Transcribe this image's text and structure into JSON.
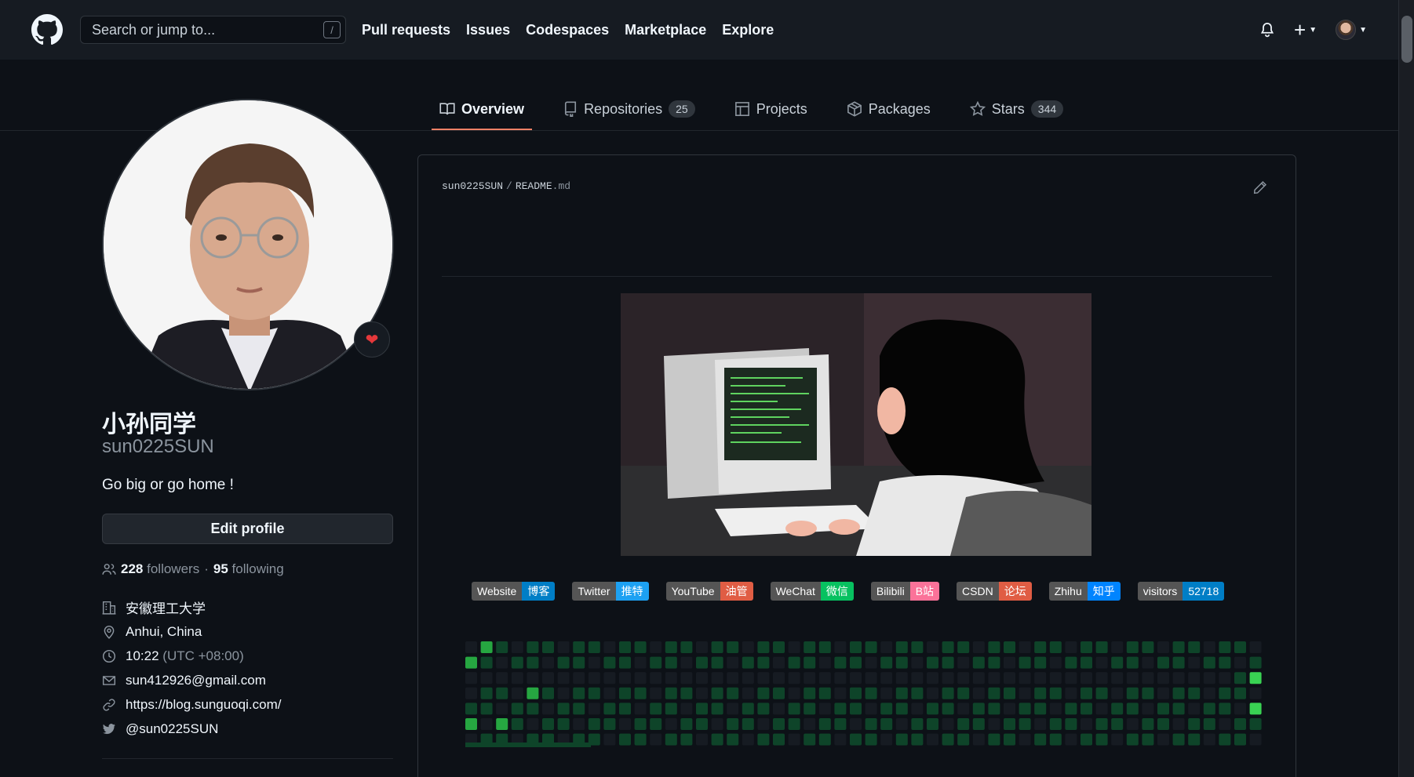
{
  "header": {
    "search_placeholder": "Search or jump to...",
    "search_shortcut": "/",
    "nav": [
      "Pull requests",
      "Issues",
      "Codespaces",
      "Marketplace",
      "Explore"
    ]
  },
  "tabs": [
    {
      "label": "Overview",
      "icon": "book-icon"
    },
    {
      "label": "Repositories",
      "count": "25",
      "icon": "repo-icon"
    },
    {
      "label": "Projects",
      "icon": "table-icon"
    },
    {
      "label": "Packages",
      "icon": "package-icon"
    },
    {
      "label": "Stars",
      "count": "344",
      "icon": "star-icon"
    }
  ],
  "profile": {
    "fullname": "小孙同学",
    "username": "sun0225SUN",
    "bio": "Go big or go home !",
    "edit_button": "Edit profile",
    "followers_count": "228",
    "followers_label": "followers",
    "dot": "·",
    "following_count": "95",
    "following_label": "following",
    "status_emoji": "❤",
    "details": {
      "organization": "安徽理工大学",
      "location": "Anhui, China",
      "time": "10:22",
      "timezone": "(UTC +08:00)",
      "email": "sun412926@gmail.com",
      "website": "https://blog.sunguoqi.com/",
      "twitter": "@sun0225SUN"
    }
  },
  "readme": {
    "owner": "sun0225SUN",
    "separator": "/",
    "filename": "README",
    "ext": ".md"
  },
  "badges": [
    {
      "left": "Website",
      "right": "博客",
      "color": "#007ec6"
    },
    {
      "left": "Twitter",
      "right": "推特",
      "color": "#1da1f2"
    },
    {
      "left": "YouTube",
      "right": "油管",
      "color": "#e05d44"
    },
    {
      "left": "WeChat",
      "right": "微信",
      "color": "#07c160"
    },
    {
      "left": "Bilibili",
      "right": "B站",
      "color": "#fb7299"
    },
    {
      "left": "CSDN",
      "right": "论坛",
      "color": "#e05d44"
    },
    {
      "left": "Zhihu",
      "right": "知乎",
      "color": "#0084ff"
    },
    {
      "left": "visitors",
      "right": "52718",
      "color": "#007ec6"
    }
  ],
  "colors": {
    "accent_tab": "#f78166",
    "contrib_level1": "#0e4429",
    "contrib_level3": "#26a641",
    "contrib_level4": "#39d353",
    "snake": "#800080"
  }
}
